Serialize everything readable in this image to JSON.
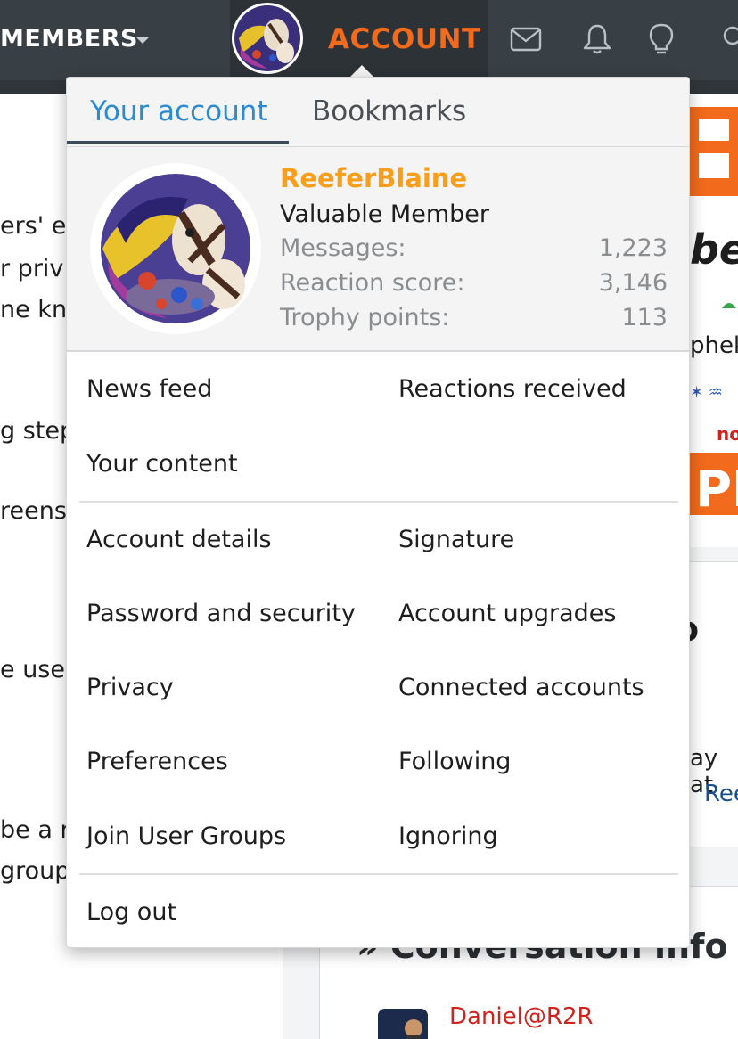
{
  "nav": {
    "members_label": "MEMBERS",
    "account_label": "ACCOUNT",
    "icons": [
      "mail-icon",
      "bell-icon",
      "lightbulb-icon",
      "search-icon"
    ]
  },
  "background": {
    "left_text": [
      "ers' ey",
      "r priv",
      "ne kn",
      "g step",
      "reens",
      "e use",
      "be a r",
      "group"
    ],
    "right_ayat": "ay at",
    "right_ree": "Ree",
    "right_o": "o",
    "conversation_heading": "» Conversation info",
    "participant_name": "Daniel@R2R"
  },
  "dropdown": {
    "tabs": {
      "your_account": "Your account",
      "bookmarks": "Bookmarks"
    },
    "profile": {
      "username": "ReeferBlaine",
      "user_title": "Valuable Member",
      "stats": [
        {
          "label": "Messages:",
          "value": "1,223"
        },
        {
          "label": "Reaction score:",
          "value": "3,146"
        },
        {
          "label": "Trophy points:",
          "value": "113"
        }
      ]
    },
    "links": {
      "news_feed": "News feed",
      "reactions_received": "Reactions received",
      "your_content": "Your content",
      "account_details": "Account details",
      "signature": "Signature",
      "password_security": "Password and security",
      "account_upgrades": "Account upgrades",
      "privacy": "Privacy",
      "connected_accounts": "Connected accounts",
      "preferences": "Preferences",
      "following": "Following",
      "join_user_groups": "Join User Groups",
      "ignoring": "Ignoring",
      "log_out": "Log out"
    }
  },
  "colors": {
    "navbar": "#394045",
    "accent_orange": "#f26a1b",
    "username_gold": "#f99e1a",
    "tab_blue": "#2a8ad2",
    "participant_red": "#d1231e"
  }
}
